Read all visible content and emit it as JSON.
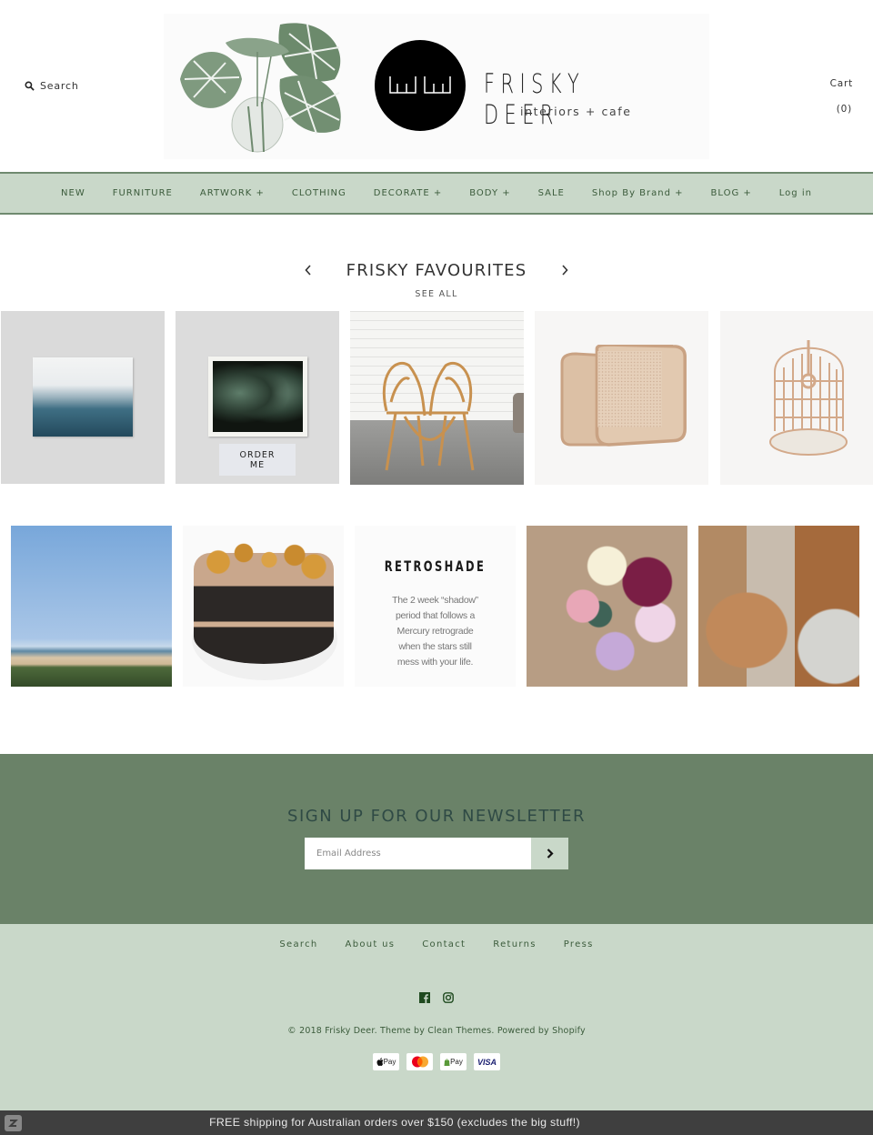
{
  "header": {
    "search_label": "Search",
    "search_icon": "search-icon",
    "brand_name": "FRISKY DEER",
    "brand_tagline": "interiors + cafe",
    "cart_label": "Cart",
    "cart_count": "(0)"
  },
  "nav": {
    "items": [
      {
        "label": "NEW"
      },
      {
        "label": "FURNITURE"
      },
      {
        "label": "ARTWORK +"
      },
      {
        "label": "CLOTHING"
      },
      {
        "label": "DECORATE +"
      },
      {
        "label": "BODY +"
      },
      {
        "label": "SALE"
      },
      {
        "label": "Shop By Brand +"
      },
      {
        "label": "BLOG +"
      },
      {
        "label": "Log in"
      }
    ]
  },
  "favourites": {
    "title": "FRISKY FAVOURITES",
    "see_all": "SEE ALL",
    "prev_icon": "chevron-left-icon",
    "next_icon": "chevron-right-icon",
    "products": [
      {
        "name": "ocean-canvas-artwork"
      },
      {
        "name": "leaf-print-artwork",
        "overlay_label_line1": "ORDER",
        "overlay_label_line2": "ME"
      },
      {
        "name": "rattan-chair"
      },
      {
        "name": "cane-armchair"
      },
      {
        "name": "hanging-rattan-chair"
      }
    ]
  },
  "instagram": {
    "tiles": [
      {
        "name": "beach-photo"
      },
      {
        "name": "pretzel-cake-photo"
      },
      {
        "name": "retroshade-quote",
        "title": "RETROSHADE",
        "body_lines": [
          "The 2 week “shadow”",
          "period that follows a",
          "Mercury retrograde",
          "when the stars still",
          "mess with your life."
        ]
      },
      {
        "name": "flower-bouquet-photo"
      },
      {
        "name": "store-display-photo"
      }
    ]
  },
  "newsletter": {
    "title": "SIGN UP FOR OUR NEWSLETTER",
    "email_placeholder": "Email Address",
    "email_value": "",
    "submit_icon": "chevron-right-icon"
  },
  "footer": {
    "links": [
      {
        "label": "Search"
      },
      {
        "label": "About us"
      },
      {
        "label": "Contact"
      },
      {
        "label": "Returns"
      },
      {
        "label": "Press"
      }
    ],
    "social": [
      "facebook-icon",
      "instagram-icon"
    ],
    "copyright": "© 2018 Frisky Deer. Theme by Clean Themes. Powered by Shopify",
    "payments": [
      {
        "label": "Pay",
        "text": "Pay",
        "name": "apple-pay"
      },
      {
        "label": "",
        "name": "mastercard"
      },
      {
        "label": "Pay",
        "name": "shopify-pay"
      },
      {
        "label": "VISA",
        "name": "visa"
      }
    ]
  },
  "announcement": {
    "text": "FREE shipping for Australian orders over $150 (excludes the big stuff!)"
  },
  "colors": {
    "nav_bg": "#c9d8c9",
    "nav_text": "#3b5b3b",
    "newsletter_bg": "#6a8268",
    "newsletter_title": "#2f4a45",
    "footer_bg": "#c9d8c9",
    "bottom_bar_bg": "#3f3f3f"
  }
}
